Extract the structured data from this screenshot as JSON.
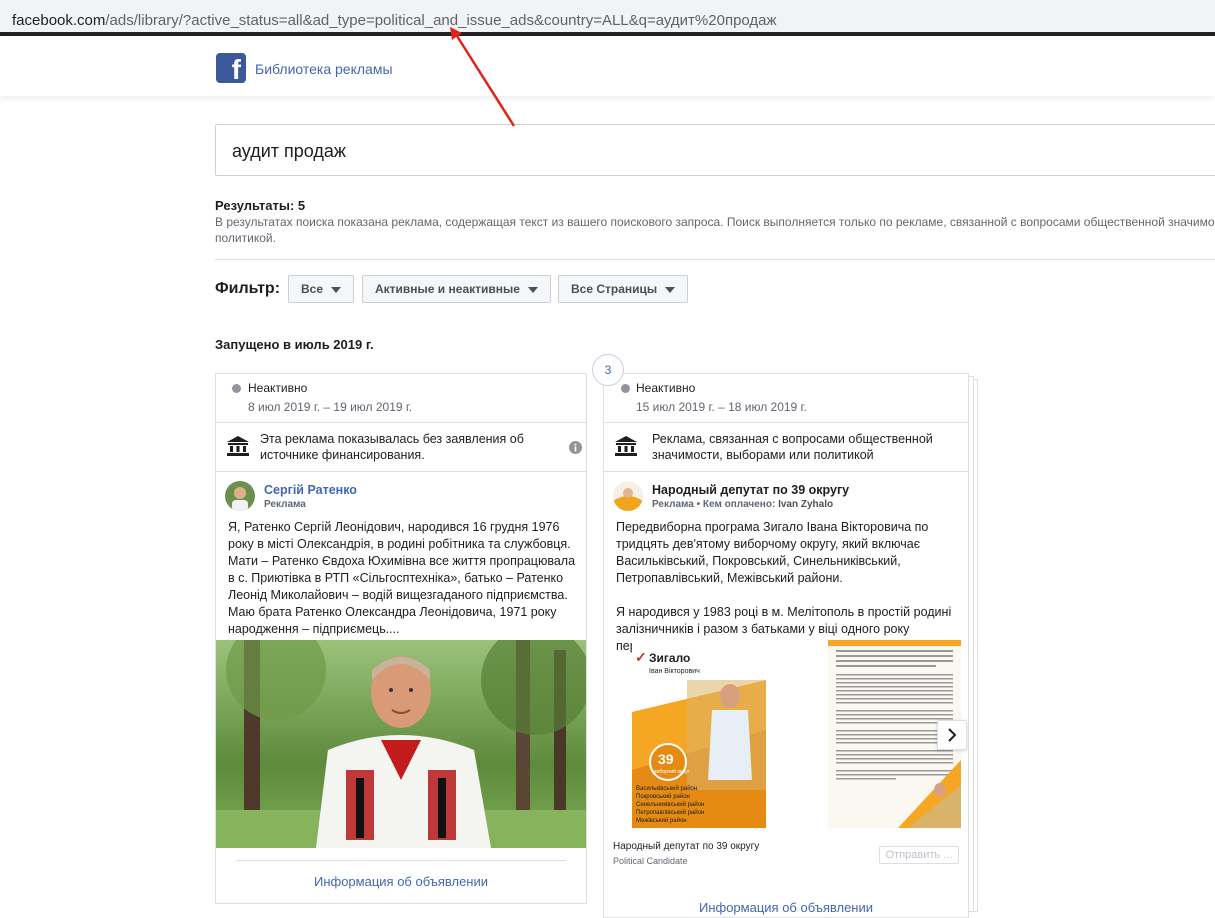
{
  "browser": {
    "url_host": "facebook.com",
    "url_rest": "/ads/library/?active_status=all&ad_type=political_and_issue_ads&country=ALL&q=аудит%20продаж"
  },
  "header": {
    "brand": "Библиотека рекламы"
  },
  "search": {
    "query": "аудит продаж"
  },
  "results": {
    "title": "Результаты: 5",
    "description": "В результатах поиска показана реклама, содержащая текст из вашего поискового запроса. Поиск выполняется только по рекламе, связанной с вопросами общественной значимо политикой."
  },
  "filters": {
    "label": "Фильтр:",
    "buttons": [
      "Все",
      "Активные и неактивные",
      "Все Страницы"
    ]
  },
  "section": {
    "launched": "Запущено в июль 2019 г."
  },
  "cards": [
    {
      "status": "Неактивно",
      "dates": "8 июл 2019 г. – 19 июл 2019 г.",
      "notice": "Эта реклама показывалась без заявления об источнике финансирования.",
      "page_name": "Сергій Ратенко",
      "page_sub": "Реклама",
      "body": "Я, Ратенко Сергій Леонідович, народився 16 грудня 1976 року в місті Олександрія, в родині робітника та службовця. Мати – Ратенко Євдоха Юхимівна все життя пропрацювала в с. Приютівка в РТП «Сільгосптехніка», батько – Ратенко Леонід Миколайович – водій вищезгаданого підприємства. Маю брата Ратенко Олександра Леонідовича, 1971 року народження – підприємець....",
      "link": "Информация об объявлении"
    },
    {
      "status": "Неактивно",
      "dates": "15 июл 2019 г. – 18 июл 2019 г.",
      "notice": "Реклама, связанная с вопросами общественной значимости, выборами или политикой",
      "page_name": "Народный депутат по 39 округу",
      "page_sub_label": "Реклама • Кем оплачено: ",
      "page_sub_payer": "Ivan Zyhalo",
      "body": "Передвиборна програма Зигало Івана Вікторовича по тридцять дев'ятому виборчому округу, який включає Васильківський, Покровський, Синельниківський, Петропавлівський, Межівський райони.\n\nЯ народився у 1983 році в м. Мелітополь в простій родині залізничників і разом з батьками у віці одного року переїхав...",
      "caption": "Народный депутат по 39 округу",
      "caption_sub": "Political Candidate",
      "send_button": "Отправить ...",
      "link": "Информация об объявлении",
      "count_badge": "3",
      "leaflet": {
        "brand": "Зигало",
        "name": "Іван Вікторович",
        "badge_number": "39",
        "badge_text": "виборчий округ",
        "districts": [
          "Васильківський район",
          "Покровський район",
          "Синельниківський район",
          "Петропавлівський район",
          "Межівський район"
        ]
      }
    }
  ],
  "colors": {
    "brand_blue": "#4267b2",
    "facebook_blue": "#3b5998",
    "arrow_red": "#e0241c",
    "leaflet_orange": "#f5a623"
  }
}
